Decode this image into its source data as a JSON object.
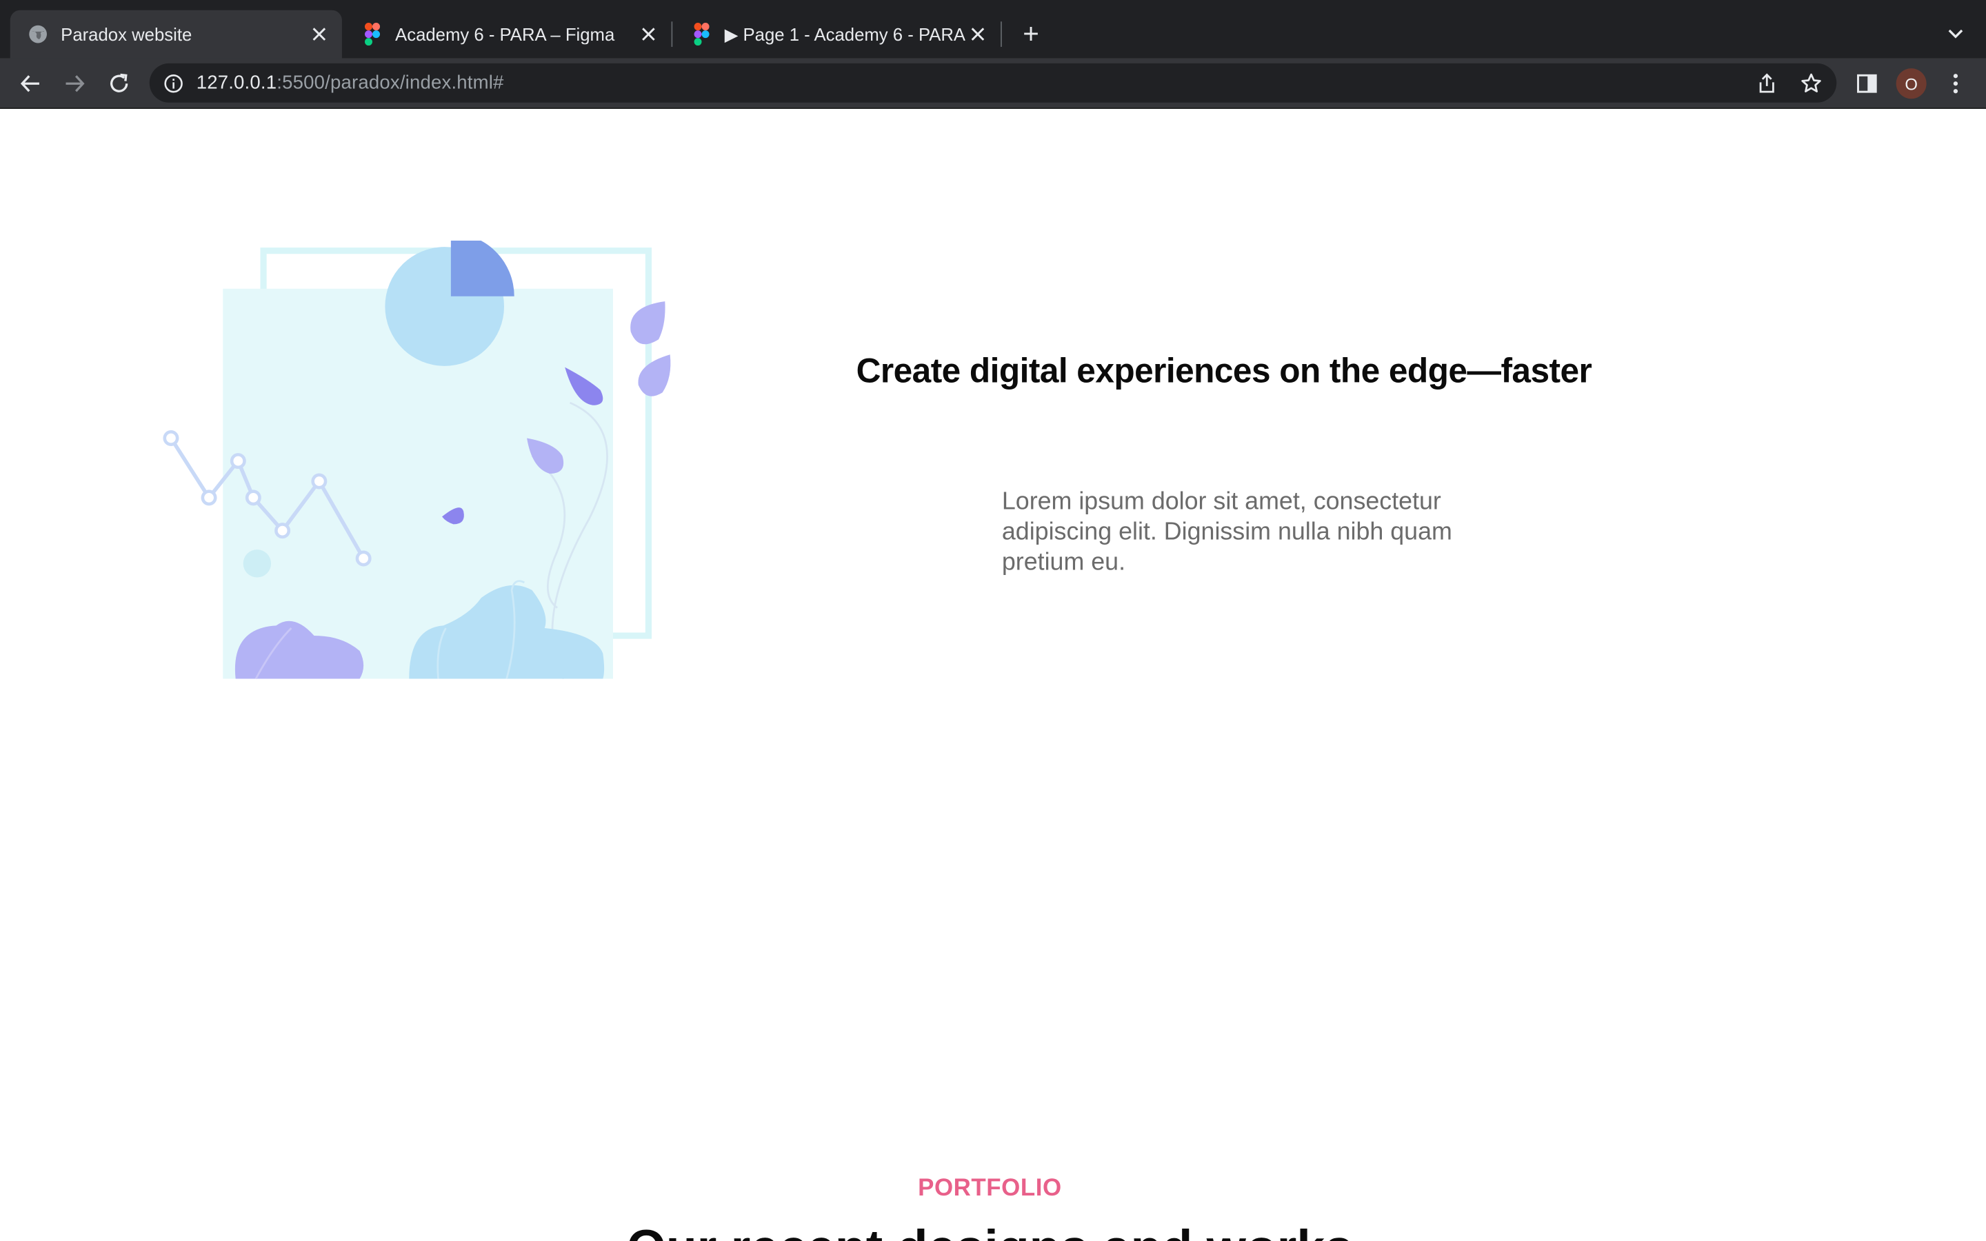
{
  "browser": {
    "tabs": [
      {
        "title": "Paradox website",
        "favicon": "globe-icon",
        "active": true
      },
      {
        "title": "Academy 6 - PARA – Figma",
        "favicon": "figma-icon",
        "active": false
      },
      {
        "title": "▶ Page 1 - Academy 6 - PARA",
        "favicon": "figma-icon",
        "active": false
      }
    ],
    "new_tab_label": "+",
    "address": {
      "host": "127.0.0.1",
      "rest": ":5500/paradox/index.html#"
    },
    "profile_initial": "O"
  },
  "page": {
    "hero": {
      "title": "Create digital experiences on the edge—faster",
      "description": "Lorem ipsum dolor sit amet, consectetur adipiscing elit. Dignissim nulla nibh quam pretium eu."
    },
    "portfolio": {
      "label": "PORTFOLIO",
      "heading": "Our recent designs and works"
    }
  },
  "colors": {
    "accent_pink": "#e8608a",
    "chrome_dark": "#202124",
    "chrome_mid": "#35363a",
    "illustration_cyan": "#e4f8fa",
    "illustration_blue": "#b6e0f6",
    "illustration_purple": "#b3b3f5"
  }
}
